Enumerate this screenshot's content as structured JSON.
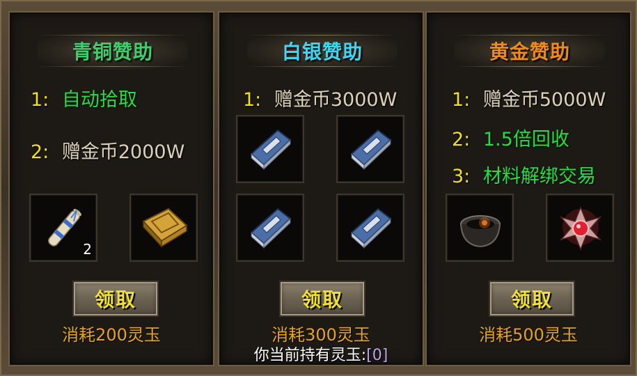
{
  "tiers": [
    {
      "title": "青铜赞助",
      "title_color": "#3fcf6a",
      "rewards": [
        {
          "index": "1:",
          "text": "自动拾取",
          "color": "#20e040"
        },
        {
          "index": "2:",
          "text": "赠金币2000W",
          "color": "#dcd2bc"
        }
      ],
      "items": [
        {
          "icon": "scroll-icon",
          "count": "2"
        },
        {
          "icon": "golden-book-icon",
          "count": ""
        }
      ],
      "button_label": "领取",
      "cost": "消耗200灵玉"
    },
    {
      "title": "白银赞助",
      "title_color": "#3fd6f0",
      "rewards": [
        {
          "index": "1:",
          "text": "赠金币3000W",
          "color": "#dcd2bc"
        }
      ],
      "items": [
        {
          "icon": "blue-book-icon",
          "count": ""
        },
        {
          "icon": "blue-book-icon",
          "count": ""
        },
        {
          "icon": "blue-book-icon",
          "count": ""
        },
        {
          "icon": "blue-book-icon",
          "count": ""
        }
      ],
      "button_label": "领取",
      "cost": "消耗300灵玉"
    },
    {
      "title": "黄金赞助",
      "title_color": "#f08a1a",
      "rewards": [
        {
          "index": "1:",
          "text": "赠金币5000W",
          "color": "#dcd2bc"
        },
        {
          "index": "2:",
          "text": "1.5倍回收",
          "color": "#20e040"
        },
        {
          "index": "3:",
          "text": "材料解绑交易",
          "color": "#20e040"
        }
      ],
      "items": [
        {
          "icon": "furnace-bowl-icon",
          "count": ""
        },
        {
          "icon": "red-gem-icon",
          "count": ""
        }
      ],
      "button_label": "领取",
      "cost": "消耗500灵玉"
    }
  ],
  "holding": {
    "label": "你当前持有灵玉:",
    "value": "[0]"
  }
}
